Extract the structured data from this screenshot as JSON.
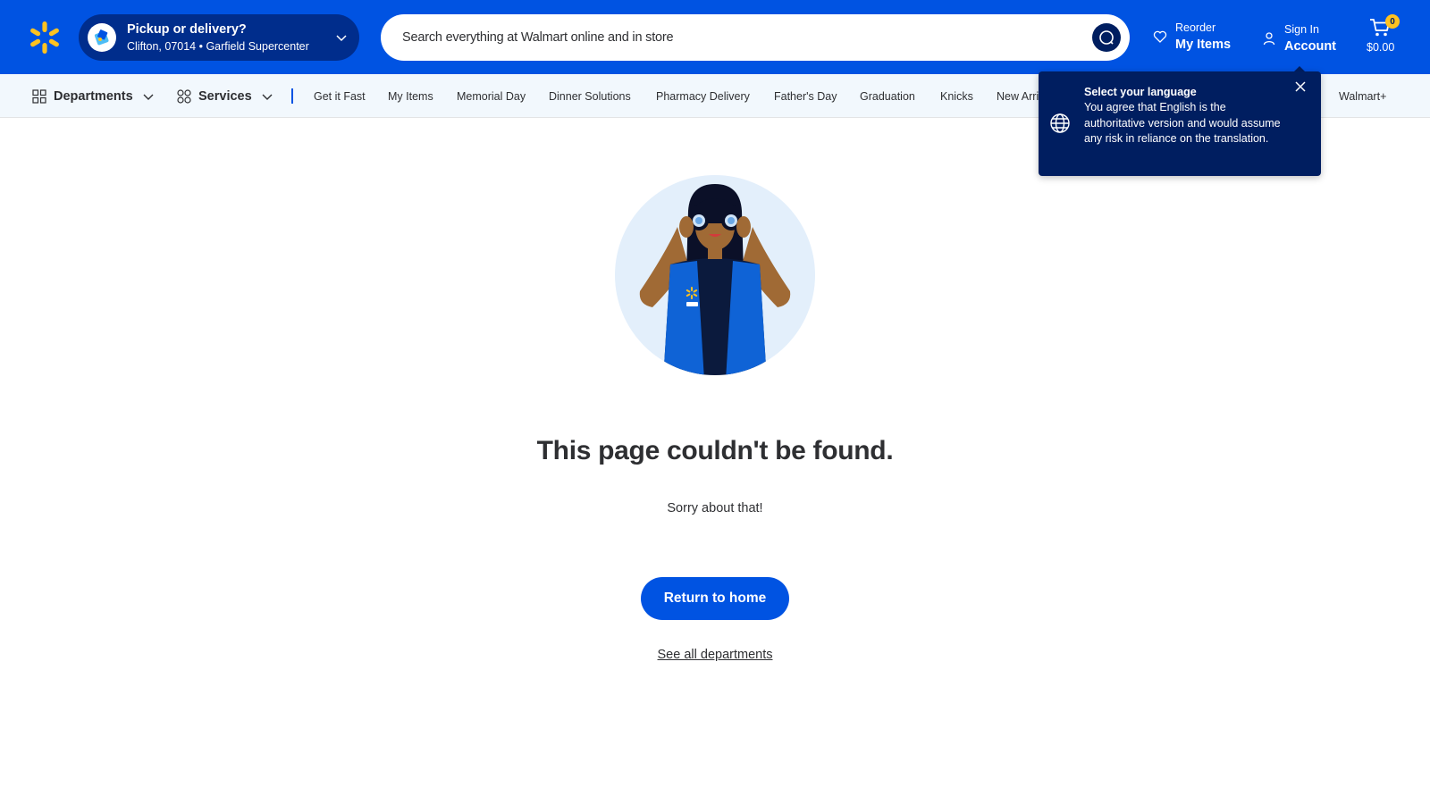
{
  "header": {
    "logo_icon": "walmart-spark-icon",
    "pickup": {
      "title": "Pickup or delivery?",
      "subtitle": "Clifton, 07014 • Garfield Supercenter",
      "icon": "pickup-delivery-icon"
    },
    "search": {
      "placeholder": "Search everything at Walmart online and in store",
      "icon": "search-icon"
    },
    "reorder": {
      "small": "Reorder",
      "big": "My Items",
      "icon": "heart-icon"
    },
    "account": {
      "small": "Sign In",
      "big": "Account",
      "icon": "user-icon"
    },
    "cart": {
      "count": "0",
      "total": "$0.00",
      "icon": "cart-icon"
    }
  },
  "nav": {
    "departments": "Departments",
    "services": "Services",
    "links": [
      "Get it Fast",
      "My Items",
      "Memorial Day",
      "Dinner Solutions",
      "Pharmacy Delivery",
      "Father's Day",
      "Graduation",
      "Knicks",
      "New Arri",
      "Walmart+"
    ]
  },
  "language_popup": {
    "title": "Select your language",
    "body": "You agree that English is the authoritative version and would assume any risk in reliance on the translation.",
    "icon": "globe-icon"
  },
  "main": {
    "title": "This page couldn't be found.",
    "subtitle": "Sorry about that!",
    "home_button": "Return to home",
    "departments_link": "See all departments"
  },
  "colors": {
    "brand_blue": "#0053e2",
    "dark_blue": "#001e60",
    "spark_yellow": "#ffc220",
    "nav_bg": "#f2f8fd"
  }
}
